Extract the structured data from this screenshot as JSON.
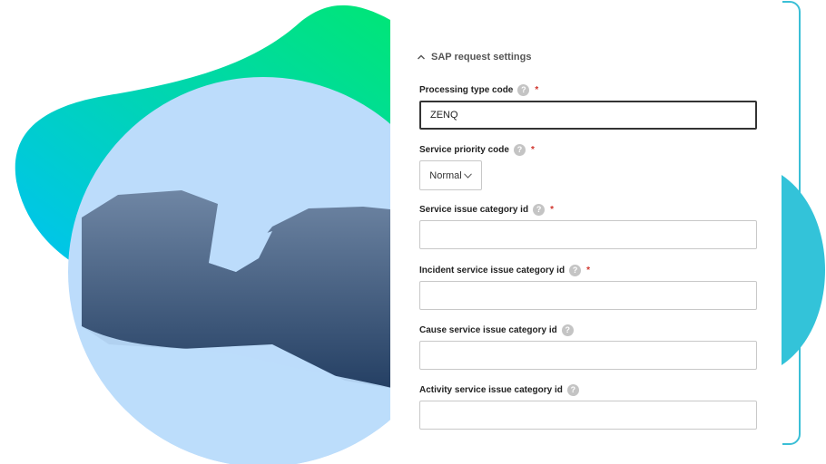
{
  "section": {
    "title": "SAP request settings",
    "icon": "chevron-up-icon",
    "expanded": true
  },
  "fields": [
    {
      "label": "Processing type code",
      "required": true,
      "help": "?",
      "type": "text",
      "value": "ZENQ",
      "placeholder": ""
    },
    {
      "label": "Service priority code",
      "required": true,
      "help": "?",
      "type": "select",
      "value": "Normal"
    },
    {
      "label": "Service issue category id",
      "required": true,
      "help": "?",
      "type": "text",
      "value": "",
      "placeholder": ""
    },
    {
      "label": "Incident service issue category id",
      "required": true,
      "help": "?",
      "type": "text",
      "value": "",
      "placeholder": ""
    },
    {
      "label": "Cause service issue category id",
      "required": false,
      "help": "?",
      "type": "text",
      "value": "",
      "placeholder": ""
    },
    {
      "label": "Activity service issue category id",
      "required": false,
      "help": "?",
      "type": "text",
      "value": "",
      "placeholder": ""
    }
  ],
  "required_marker": "*",
  "colors": {
    "accent": "#3bbfd6",
    "blob_start": "#00c2f5",
    "blob_end": "#00e676",
    "required": "#d0342c",
    "image_tint": "#bcdcfb"
  }
}
